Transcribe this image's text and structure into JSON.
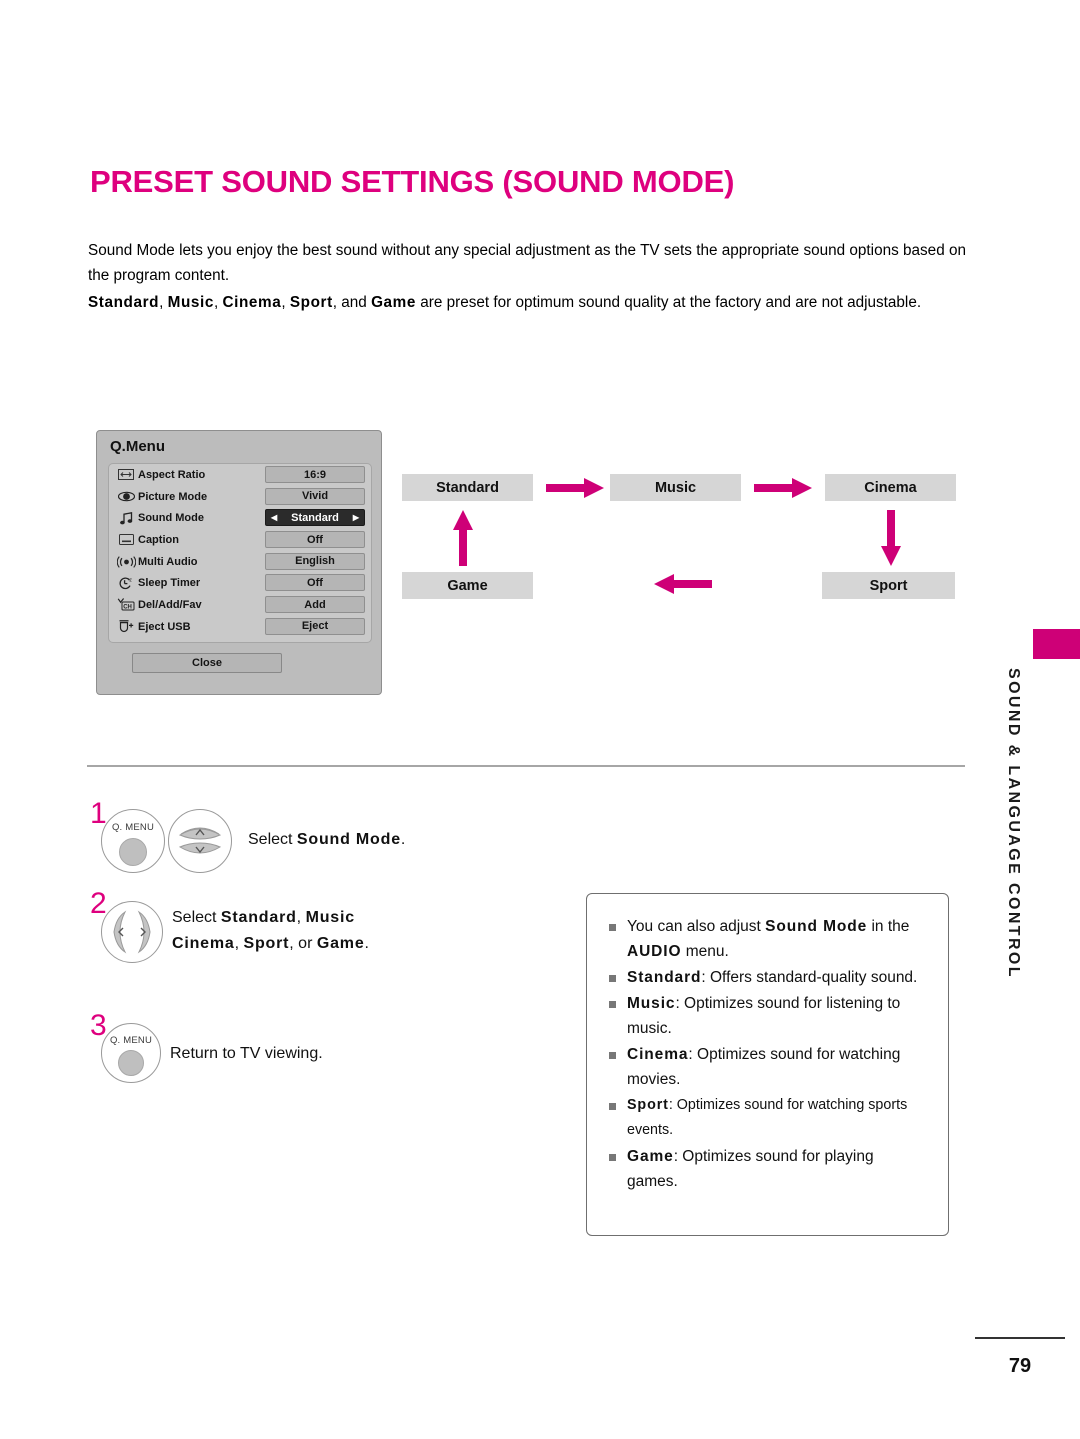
{
  "document": {
    "title": "PRESET SOUND SETTINGS (SOUND MODE)",
    "title_color": "#DE007E",
    "page_number": "79",
    "side_tab_label": "SOUND & LANGUAGE CONTROL",
    "side_tab_color": "#CE0077"
  },
  "intro": {
    "line1_a": "Sound Mode lets you enjoy the best sound without any special adjustment as the TV sets the appropriate sound options based on the program content.",
    "bold_modes": {
      "standard": "Standard",
      "music": "Music",
      "cinema": "Cinema",
      "sport": "Sport",
      "game": "Game"
    },
    "line2_sep1": ", ",
    "line2_sep2": ", and ",
    "line2_tail": " are preset for optimum sound quality at the factory and are not adjustable."
  },
  "qmenu": {
    "title": "Q.Menu",
    "close_label": "Close",
    "rows": [
      {
        "icon": "aspect-ratio-icon",
        "label": "Aspect Ratio",
        "value": "16:9",
        "selected": false
      },
      {
        "icon": "picture-mode-icon",
        "label": "Picture Mode",
        "value": "Vivid",
        "selected": false
      },
      {
        "icon": "sound-mode-icon",
        "label": "Sound Mode",
        "value": "Standard",
        "selected": true,
        "left_arrow": "◀",
        "right_arrow": "▶"
      },
      {
        "icon": "caption-icon",
        "label": "Caption",
        "value": "Off",
        "selected": false
      },
      {
        "icon": "multi-audio-icon",
        "label": "Multi Audio",
        "value": "English",
        "selected": false
      },
      {
        "icon": "sleep-timer-icon",
        "label": "Sleep Timer",
        "value": "Off",
        "selected": false
      },
      {
        "icon": "del-add-fav-icon",
        "label": "Del/Add/Fav",
        "value": "Add",
        "selected": false
      },
      {
        "icon": "eject-usb-icon",
        "label": "Eject USB",
        "value": "Eject",
        "selected": false
      }
    ]
  },
  "flow": {
    "arrow_color": "#CE0077",
    "box_color": "#d6d6d6",
    "nodes": {
      "standard": "Standard",
      "music": "Music",
      "cinema": "Cinema",
      "sport": "Sport",
      "game": "Game"
    },
    "transitions": [
      {
        "from": "Standard",
        "to": "Music",
        "direction": "right"
      },
      {
        "from": "Music",
        "to": "Cinema",
        "direction": "right"
      },
      {
        "from": "Cinema",
        "to": "Sport",
        "direction": "down"
      },
      {
        "from": "Sport",
        "to": "Game",
        "direction": "left"
      },
      {
        "from": "Game",
        "to": "Standard",
        "direction": "up"
      }
    ]
  },
  "steps": [
    {
      "number": "1",
      "buttons": [
        {
          "name": "q-menu-button",
          "label": "Q. MENU"
        },
        {
          "name": "up-down-button",
          "label": ""
        }
      ],
      "text_pre": "Select ",
      "text_bold": "Sound Mode",
      "text_post": "."
    },
    {
      "number": "2",
      "buttons": [
        {
          "name": "left-right-button",
          "label": ""
        }
      ],
      "text_pre": "Select ",
      "text_bold_1": "Standard",
      "text_bold_2": "Music",
      "text_bold_3": "Cinema",
      "text_bold_4": "Sport",
      "text_bold_5": "Game",
      "sep": ", ",
      "or": ", or ",
      "text_post": "."
    },
    {
      "number": "3",
      "buttons": [
        {
          "name": "q-menu-button",
          "label": "Q. MENU"
        }
      ],
      "text_plain": "Return to TV viewing."
    }
  ],
  "notes": [
    {
      "pre": "You can also adjust ",
      "bold": "Sound Mode",
      "mid": " in the ",
      "bold2": "AUDIO",
      "post": " menu."
    },
    {
      "bold": "Standard",
      "post": ": Offers standard-quality sound."
    },
    {
      "bold": "Music",
      "post": ": Optimizes sound for listening to music."
    },
    {
      "bold": "Cinema",
      "post": ": Optimizes sound for watching movies."
    },
    {
      "bold": "Sport",
      "post": ": Optimizes sound for watching sports events.",
      "small": true
    },
    {
      "bold": "Game",
      "post": ": Optimizes sound for playing games."
    }
  ]
}
